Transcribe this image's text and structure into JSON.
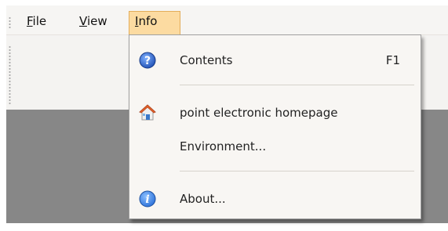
{
  "menubar": {
    "items": [
      {
        "prefix": "",
        "mnemonic": "F",
        "rest": "ile"
      },
      {
        "prefix": "",
        "mnemonic": "V",
        "rest": "iew"
      },
      {
        "prefix": "",
        "mnemonic": "I",
        "rest": "nfo"
      }
    ],
    "active_index": 2
  },
  "info_menu": {
    "items": [
      {
        "label": "Contents",
        "shortcut": "F1",
        "icon": "help-icon"
      },
      {
        "label": "point electronic homepage",
        "icon": "home-icon"
      },
      {
        "label": "Environment...",
        "icon": ""
      },
      {
        "label": "About...",
        "icon": "info-icon"
      }
    ]
  },
  "colors": {
    "active_menu_bg": "#fcdba1",
    "workspace": "#878787",
    "help_icon_blue": "#1f4fb3",
    "info_icon_blue": "#2a6fd8"
  }
}
